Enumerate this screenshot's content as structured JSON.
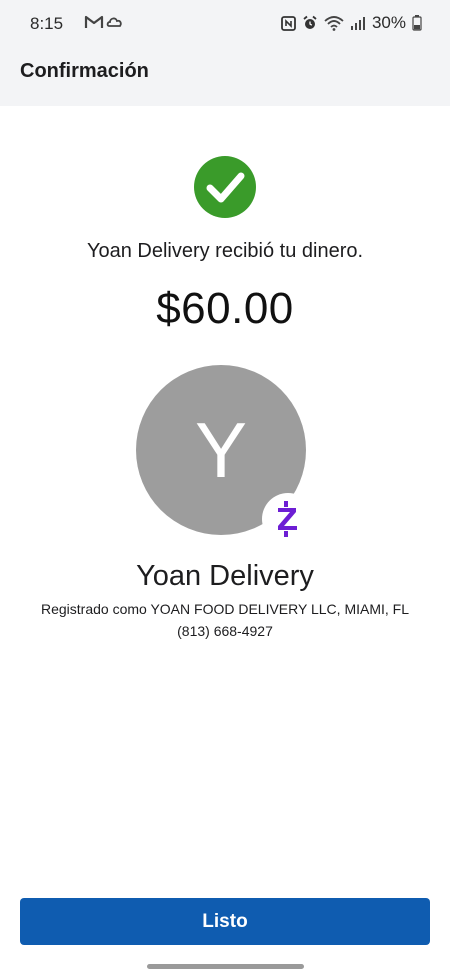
{
  "status_bar": {
    "time": "8:15",
    "battery_percent": "30%",
    "left_icons": [
      "gmail-icon",
      "cloud-icon"
    ],
    "right_icons": [
      "nfc-icon",
      "alarm-icon",
      "wifi-icon",
      "signal-icon",
      "battery-icon"
    ]
  },
  "header": {
    "title": "Confirmación"
  },
  "confirmation": {
    "message": "Yoan Delivery recibió tu dinero.",
    "amount": "$60.00",
    "check_color": "#3a9b2a"
  },
  "recipient": {
    "avatar_letter": "Y",
    "avatar_color": "#9d9d9d",
    "name": "Yoan Delivery",
    "registered_as": "Registrado como YOAN FOOD DELIVERY LLC, MIAMI, FL",
    "phone": "(813) 668-4927",
    "badge_icon": "zelle-icon",
    "badge_color": "#6d1ed4"
  },
  "actions": {
    "done_label": "Listo",
    "button_color": "#0f5cb0"
  }
}
